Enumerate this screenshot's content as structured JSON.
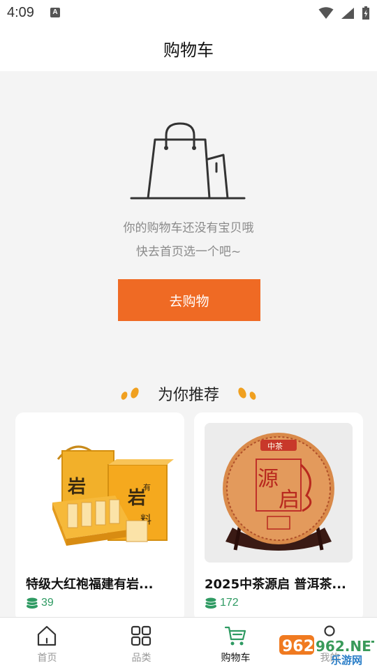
{
  "status_bar": {
    "time": "4:09",
    "notification_badge": "A"
  },
  "header": {
    "title": "购物车"
  },
  "empty_cart": {
    "message_line1": "你的购物车还没有宝贝哦",
    "message_line2": "快去首页选一个吧~",
    "button_label": "去购物"
  },
  "recommend": {
    "title": "为你推荐",
    "products": [
      {
        "name": "特级大红袍福建有岩...",
        "price": "39",
        "box_text": "岩有料"
      },
      {
        "name": "2025中茶源启 普洱茶...",
        "price": "172",
        "cake_text": "源启",
        "brand_text": "中茶"
      }
    ]
  },
  "tabbar": {
    "items": [
      {
        "label": "首页",
        "icon": "home-icon",
        "active": false
      },
      {
        "label": "品类",
        "icon": "grid-icon",
        "active": false
      },
      {
        "label": "购物车",
        "icon": "cart-icon",
        "active": true
      },
      {
        "label": "我的",
        "icon": "user-icon",
        "active": false
      }
    ]
  },
  "watermark": {
    "text": "962.NET",
    "subtext": "乐游网"
  },
  "colors": {
    "accent": "#ef6a24",
    "price_green": "#2e9a62",
    "deco_orange": "#f0a020"
  }
}
